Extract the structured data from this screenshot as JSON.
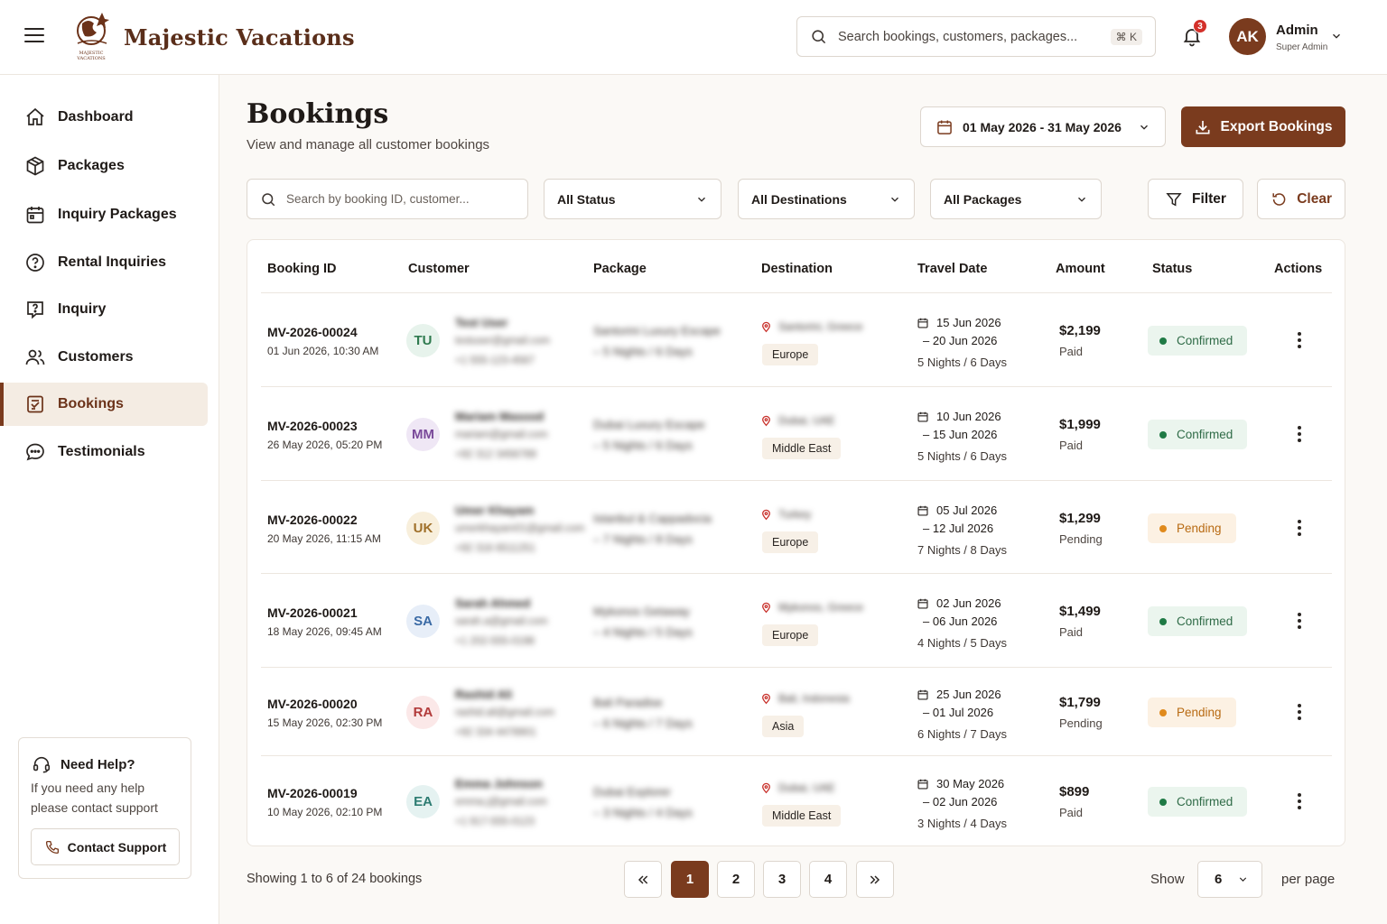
{
  "header": {
    "brand": "Majestic Vacations",
    "logo_text": "MAJESTIC VACATIONS",
    "search_placeholder": "Search bookings, customers, packages...",
    "shortcut": "⌘ K",
    "notification_count": "3",
    "user": {
      "initials": "AK",
      "name": "Admin",
      "role": "Super Admin"
    }
  },
  "sidebar": {
    "items": [
      {
        "label": "Dashboard",
        "icon": "home-icon"
      },
      {
        "label": "Packages",
        "icon": "package-icon"
      },
      {
        "label": "Inquiry Packages",
        "icon": "calendar-icon"
      },
      {
        "label": "Rental Inquiries",
        "icon": "question-circle-icon"
      },
      {
        "label": "Inquiry",
        "icon": "question-square-icon"
      },
      {
        "label": "Customers",
        "icon": "users-icon"
      },
      {
        "label": "Bookings",
        "icon": "booking-icon",
        "active": true
      },
      {
        "label": "Testimonials",
        "icon": "chat-icon"
      }
    ],
    "help": {
      "title": "Need Help?",
      "text": "If you need any help please contact support",
      "button": "Contact Support"
    }
  },
  "main": {
    "title": "Bookings",
    "subtitle": "View and manage all customer bookings",
    "date_range": "01 May 2026 - 31 May 2026",
    "export_label": "Export Bookings",
    "filters": {
      "search_placeholder": "Search by booking ID, customer...",
      "status": "All Status",
      "destinations": "All Destinations",
      "packages": "All Packages",
      "filter_label": "Filter",
      "clear_label": "Clear"
    },
    "table": {
      "columns": [
        "Booking ID",
        "Customer",
        "Package",
        "Destination",
        "Travel Date",
        "Amount",
        "Status",
        "Actions"
      ],
      "rows": [
        {
          "id": "MV-2026-00024",
          "booked": "01 Jun 2026, 10:30 AM",
          "initials": "TU",
          "name": "Test User",
          "email": "testuser@gmail.com",
          "phone": "+1 555-123-4567",
          "package": "Santorini Luxury Escape",
          "duration": "– 5 Nights / 6 Days",
          "destination": "Santorini, Greece",
          "region": "Europe",
          "start": "15 Jun 2026",
          "end": "– 20 Jun 2026",
          "nights": "5 Nights / 6 Days",
          "amount": "$2,199",
          "payment": "Paid",
          "status": "Confirmed"
        },
        {
          "id": "MV-2026-00023",
          "booked": "26 May 2026, 05:20 PM",
          "initials": "MM",
          "name": "Mariam Masood",
          "email": "mariam@gmail.com",
          "phone": "+92 312 3456789",
          "package": "Dubai Luxury Escape",
          "duration": "– 5 Nights / 6 Days",
          "destination": "Dubai, UAE",
          "region": "Middle East",
          "start": "10 Jun 2026",
          "end": "– 15 Jun 2026",
          "nights": "5 Nights / 6 Days",
          "amount": "$1,999",
          "payment": "Paid",
          "status": "Confirmed"
        },
        {
          "id": "MV-2026-00022",
          "booked": "20 May 2026, 11:15 AM",
          "initials": "UK",
          "name": "Umer Khayam",
          "email": "umerkhayam01@gmail.com",
          "phone": "+92 316 6511251",
          "package": "Istanbul & Cappadocia",
          "duration": "– 7 Nights / 8 Days",
          "destination": "Turkey",
          "region": "Europe",
          "start": "05 Jul 2026",
          "end": "– 12 Jul 2026",
          "nights": "7 Nights / 8 Days",
          "amount": "$1,299",
          "payment": "Pending",
          "status": "Pending"
        },
        {
          "id": "MV-2026-00021",
          "booked": "18 May 2026, 09:45 AM",
          "initials": "SA",
          "name": "Sarah Ahmed",
          "email": "sarah.a@gmail.com",
          "phone": "+1 202-555-0198",
          "package": "Mykonos Getaway",
          "duration": "– 4 Nights / 5 Days",
          "destination": "Mykonos, Greece",
          "region": "Europe",
          "start": "02 Jun 2026",
          "end": "– 06 Jun 2026",
          "nights": "4 Nights / 5 Days",
          "amount": "$1,499",
          "payment": "Paid",
          "status": "Confirmed"
        },
        {
          "id": "MV-2026-00020",
          "booked": "15 May 2026, 02:30 PM",
          "initials": "RA",
          "name": "Rashid Ali",
          "email": "rashid.ali@gmail.com",
          "phone": "+92 334 4478901",
          "package": "Bali Paradise",
          "duration": "– 6 Nights / 7 Days",
          "destination": "Bali, Indonesia",
          "region": "Asia",
          "start": "25 Jun 2026",
          "end": "– 01 Jul 2026",
          "nights": "6 Nights / 7 Days",
          "amount": "$1,799",
          "payment": "Pending",
          "status": "Pending"
        },
        {
          "id": "MV-2026-00019",
          "booked": "10 May 2026, 02:10 PM",
          "initials": "EA",
          "name": "Emma Johnson",
          "email": "emma.j@gmail.com",
          "phone": "+1 917-555-0123",
          "package": "Dubai Explorer",
          "duration": "– 3 Nights / 4 Days",
          "destination": "Dubai, UAE",
          "region": "Middle East",
          "start": "30 May 2026",
          "end": "– 02 Jun 2026",
          "nights": "3 Nights / 4 Days",
          "amount": "$899",
          "payment": "Paid",
          "status": "Confirmed"
        }
      ]
    },
    "footer": {
      "showing": "Showing 1 to 6 of 24 bookings",
      "pages": [
        "1",
        "2",
        "3",
        "4"
      ],
      "current_page": "1",
      "show_label": "Show",
      "per_page": "6",
      "per_page_label": "per page"
    }
  },
  "colors": {
    "brand": "#7a3b1e",
    "confirmed": "#1f7a45",
    "pending": "#e08a1c",
    "avatar_bg": [
      "#e7f3ec",
      "#efe7f5",
      "#f8efdc",
      "#e7eef8",
      "#fbe8e8",
      "#e5f2f1"
    ],
    "avatar_fg": [
      "#2f7a4f",
      "#7a4a9a",
      "#a0702a",
      "#3a6aa5",
      "#b23a3a",
      "#2d7c72"
    ]
  }
}
